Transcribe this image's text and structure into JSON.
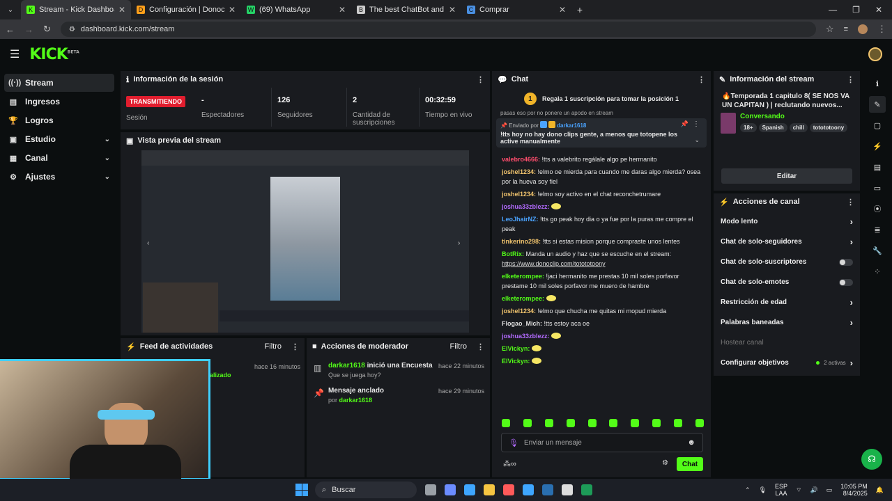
{
  "browser": {
    "tabs": [
      {
        "label": "Stream - Kick Dashboard",
        "color": "#53fc18",
        "glyph": "K"
      },
      {
        "label": "Configuración | Donoclip",
        "color": "#ff9f1a",
        "glyph": "D"
      },
      {
        "label": "(69) WhatsApp",
        "color": "#25d366",
        "glyph": "W"
      },
      {
        "label": "The best ChatBot and Widgets",
        "color": "#cccccc",
        "glyph": "B"
      },
      {
        "label": "Comprar",
        "color": "#4a90e2",
        "glyph": "C"
      }
    ],
    "url": "dashboard.kick.com/stream"
  },
  "header": {
    "logo": "KICK",
    "logo_sup": "BETA"
  },
  "sidebar": {
    "items": [
      {
        "label": "Stream",
        "icon": "broadcast-icon",
        "glyph": "((·))"
      },
      {
        "label": "Ingresos",
        "icon": "dollar-icon",
        "glyph": "▤"
      },
      {
        "label": "Logros",
        "icon": "trophy-icon",
        "glyph": "🏆"
      },
      {
        "label": "Estudio",
        "icon": "studio-icon",
        "glyph": "▣"
      },
      {
        "label": "Canal",
        "icon": "channel-icon",
        "glyph": "▦"
      },
      {
        "label": "Ajustes",
        "icon": "gear-icon",
        "glyph": "⚙"
      }
    ]
  },
  "session": {
    "title": "Información de la sesión",
    "live_badge": "TRANSMITIENDO",
    "session_label": "Sesión",
    "stats": [
      {
        "value": "-",
        "label": "Espectadores"
      },
      {
        "value": "126",
        "label": "Seguidores"
      },
      {
        "value": "2",
        "label": "Cantidad de suscripciones"
      },
      {
        "value": "00:32:59",
        "label": "Tiempo en vivo"
      }
    ]
  },
  "preview": {
    "title": "Vista previa del stream"
  },
  "activity": {
    "title": "Feed de actividades",
    "filter": "Filtro",
    "partial": "alizado",
    "time": "hace 16 minutos"
  },
  "mod": {
    "title": "Acciones de moderador",
    "filter": "Filtro",
    "items": [
      {
        "user": "darkar1618",
        "action": " inició una Encuesta",
        "sub": "Que se juega hoy?",
        "time": "hace 22 minutos"
      },
      {
        "user": "",
        "action": "Mensaje anclado",
        "sub_prefix": "por ",
        "sub_user": "darkar1618",
        "time": "hace 29 minutos"
      }
    ]
  },
  "chat": {
    "title": "Chat",
    "banner_num": "1",
    "banner": "Regala 1 suscripción para tomar la posición 1",
    "cut_text": "pasas eso por no ponere un apodo en stream",
    "pinned_by": "Enviado por",
    "pinned_user": "darkar1618",
    "pinned_text": "!tts hoy no hay dono clips gente, a menos que totopene los active manualmente",
    "messages": [
      {
        "user": "valebro4666",
        "color": "#ff4d6d",
        "text": "!tts a valebrito regálale algo pe hermanito"
      },
      {
        "user": "joshel1234",
        "color": "#f0c36d",
        "text": "!elmo oe mierda para cuando me daras algo mierda? osea por la hueva soy fiel"
      },
      {
        "user": "joshel1234",
        "color": "#f0c36d",
        "text": "!elmo soy activo en el chat reconchetrumare"
      },
      {
        "user": "joshua33zblezz",
        "color": "#b36bff",
        "text": ""
      },
      {
        "user": "LeoJhairNZ",
        "color": "#4aa3ff",
        "text": "!tts go peak hoy dia o ya fue por la puras me compre el peak"
      },
      {
        "user": "tinkerino298",
        "color": "#f0c36d",
        "text": "!tts si estas mision porque compraste unos lentes"
      },
      {
        "user": "BotRix",
        "color": "#53fc18",
        "text": "Manda un audio y haz que se escuche en el stream:",
        "link": "https://www.donoclip.com/totototoony"
      },
      {
        "user": "elketerompee",
        "color": "#53fc18",
        "text": "!jaci hermanito me prestas 10 mil soles porfavor prestame 10 mil soles porfavor me muero de hambre"
      },
      {
        "user": "elketerompee",
        "color": "#53fc18",
        "text": ""
      },
      {
        "user": "joshel1234",
        "color": "#f0c36d",
        "text": "!elmo que chucha me quitas mi mopud mierda"
      },
      {
        "user": "Flogao_Mich",
        "color": "#dddddd",
        "text": "!tts estoy aca oe"
      },
      {
        "user": "joshua33zblezz",
        "color": "#b36bff",
        "text": ""
      },
      {
        "user": "ElVickyn",
        "color": "#53fc18",
        "text": ""
      },
      {
        "user": "ElVickyn",
        "color": "#53fc18",
        "text": ""
      }
    ],
    "placeholder": "Enviar un mensaje",
    "send": "Chat"
  },
  "streaminfo": {
    "title": "Información del stream",
    "stream_title": "🔥Temporada 1 capitulo 8( SE NOS VA UN CAPITAN ) | reclutando nuevos...",
    "category": "Conversando",
    "tags": [
      "18+",
      "Spanish",
      "chill",
      "totototoony"
    ],
    "edit": "Editar"
  },
  "actions": {
    "title": "Acciones de canal",
    "rows": [
      {
        "label": "Modo lento",
        "kind": "chev"
      },
      {
        "label": "Chat de solo-seguidores",
        "kind": "chev"
      },
      {
        "label": "Chat de solo-suscriptores",
        "kind": "toggle"
      },
      {
        "label": "Chat de solo-emotes",
        "kind": "toggle"
      },
      {
        "label": "Restricción de edad",
        "kind": "chev"
      },
      {
        "label": "Palabras baneadas",
        "kind": "chev"
      },
      {
        "label": "Hostear canal",
        "kind": "disabled"
      },
      {
        "label": "Configurar objetivos",
        "kind": "chev",
        "extra": "2 activas"
      }
    ]
  },
  "taskbar": {
    "search": "Buscar",
    "lang": "ESP",
    "region": "LAA",
    "time": "10:05 PM",
    "date": "8/4/2025"
  },
  "colors": {
    "accent": "#53fc18",
    "live": "#e11d2e"
  }
}
